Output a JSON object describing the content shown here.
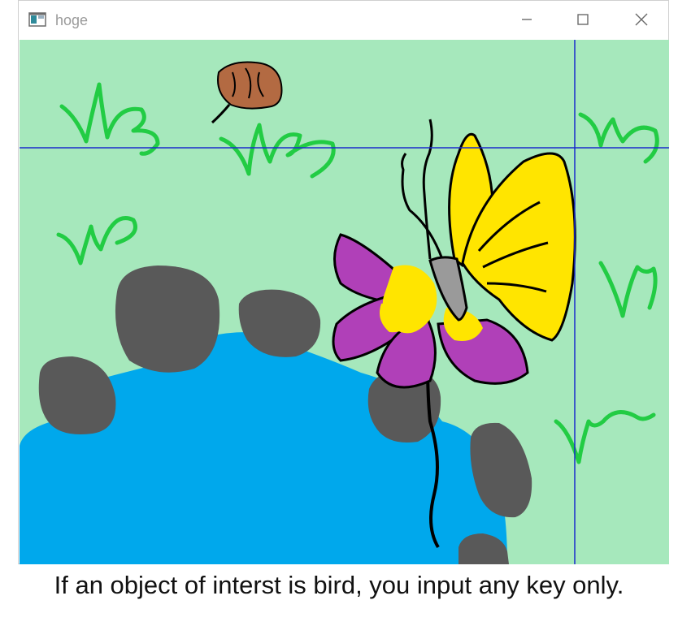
{
  "window": {
    "title": "hoge",
    "icon": "app-window-icon",
    "controls": {
      "minimize_icon": "minimize-icon",
      "maximize_icon": "maximize-icon",
      "close_icon": "close-icon"
    }
  },
  "scene": {
    "background_color": "#a6e8bc",
    "water_color": "#00a8ec",
    "rock_color": "#595959",
    "grass_color": "#22cc44",
    "crosshair_color": "#1a2acc",
    "flower_color": "#b040b8",
    "butterfly_color": "#ffe500",
    "beetle_color": "#b36a42"
  },
  "caption": {
    "text": "If an object of interst is bird, you input any key only."
  }
}
